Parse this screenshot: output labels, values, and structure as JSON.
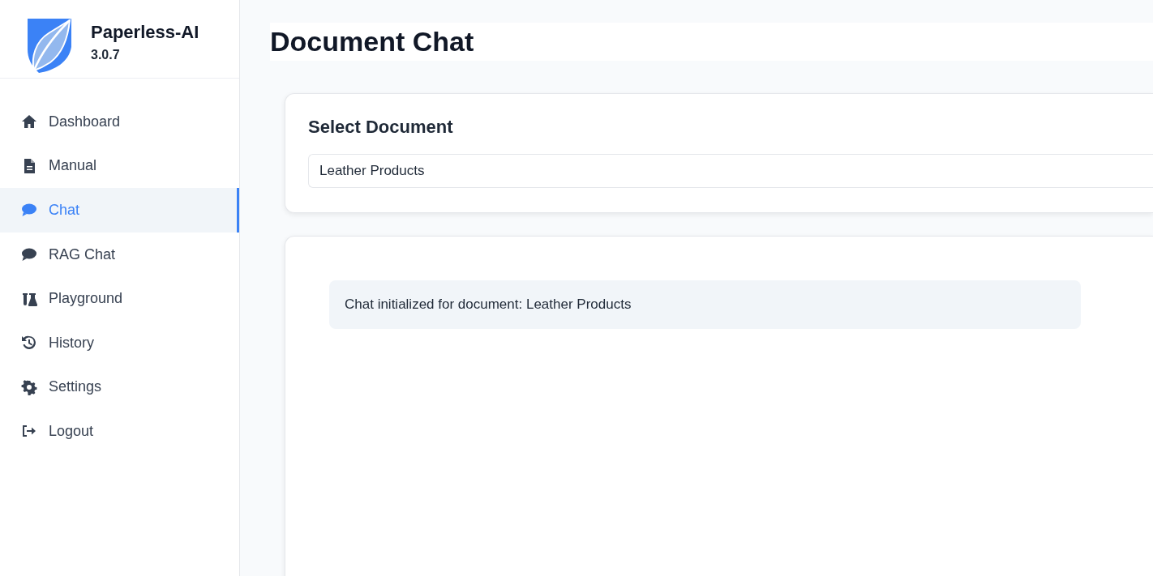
{
  "app": {
    "name": "Paperless-AI",
    "version": "3.0.7"
  },
  "sidebar": {
    "items": [
      {
        "label": "Dashboard",
        "kind": "home",
        "selected": false
      },
      {
        "label": "Manual",
        "kind": "file",
        "selected": false
      },
      {
        "label": "Chat",
        "kind": "chat",
        "selected": true
      },
      {
        "label": "RAG Chat",
        "kind": "chat",
        "selected": false
      },
      {
        "label": "Playground",
        "kind": "flask",
        "selected": false
      },
      {
        "label": "History",
        "kind": "history",
        "selected": false
      },
      {
        "label": "Settings",
        "kind": "gear",
        "selected": false
      },
      {
        "label": "Logout",
        "kind": "logout",
        "selected": false
      }
    ]
  },
  "page_title": "Document Chat",
  "select_document": {
    "heading": "Select Document",
    "value": "Leather Products"
  },
  "chat": {
    "messages": [
      {
        "text": "Chat initialized for document: Leather Products"
      }
    ]
  }
}
